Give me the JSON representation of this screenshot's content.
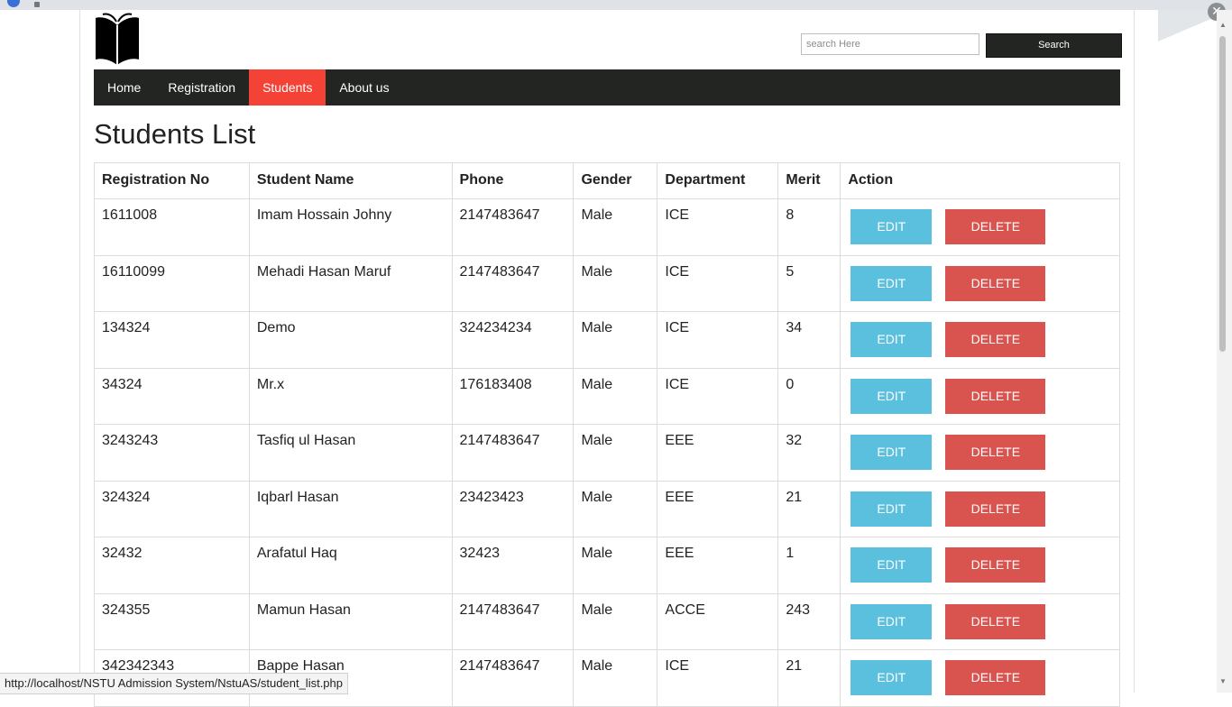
{
  "search": {
    "placeholder": "search Here",
    "button_label": "Search"
  },
  "nav": {
    "items": [
      {
        "label": "Home"
      },
      {
        "label": "Registration"
      },
      {
        "label": "Students"
      },
      {
        "label": "About us"
      }
    ]
  },
  "page_title": "Students List",
  "table": {
    "columns": [
      "Registration No",
      "Student Name",
      "Phone",
      "Gender",
      "Department",
      "Merit",
      "Action"
    ],
    "edit_label": "EDIT",
    "delete_label": "DELETE",
    "rows": [
      [
        "1611008",
        "Imam Hossain Johny",
        "2147483647",
        "Male",
        "ICE",
        "8"
      ],
      [
        "16110099",
        "Mehadi Hasan Maruf",
        "2147483647",
        "Male",
        "ICE",
        "5"
      ],
      [
        "134324",
        "Demo",
        "324234234",
        "Male",
        "ICE",
        "34"
      ],
      [
        "34324",
        "Mr.x",
        "176183408",
        "Male",
        "ICE",
        "0"
      ],
      [
        "3243243",
        "Tasfiq ul Hasan",
        "2147483647",
        "Male",
        "EEE",
        "32"
      ],
      [
        "324324",
        "Iqbarl Hasan",
        "23423423",
        "Male",
        "EEE",
        "21"
      ],
      [
        "32432",
        "Arafatul Haq",
        "32423",
        "Male",
        "EEE",
        "1"
      ],
      [
        "324355",
        "Mamun Hasan",
        "2147483647",
        "Male",
        "ACCE",
        "243"
      ],
      [
        "342342343",
        "Bappe Hasan",
        "2147483647",
        "Male",
        "ICE",
        "21"
      ]
    ]
  },
  "status_url": "http://localhost/NSTU Admission System/NstuAS/student_list.php",
  "colors": {
    "nav_bg": "#222522",
    "active_tab": "#f44336",
    "edit": "#5bc0de",
    "delete": "#d9534f"
  }
}
